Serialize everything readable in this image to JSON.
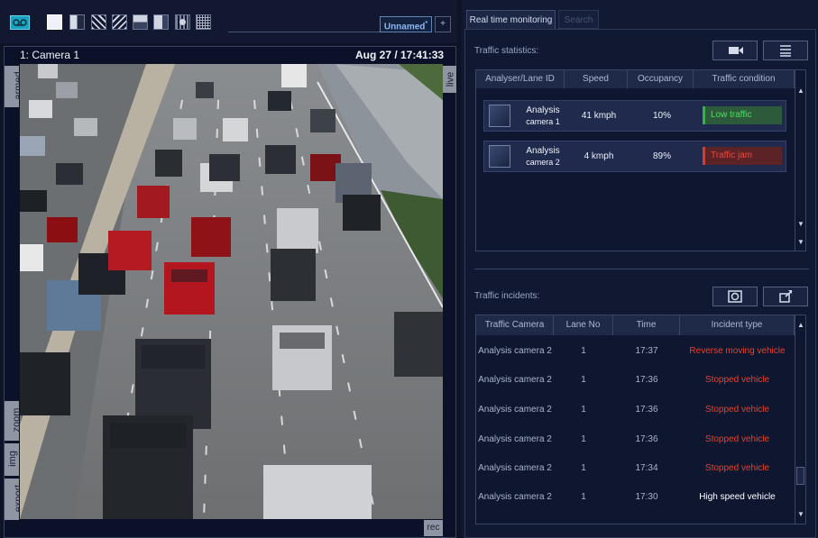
{
  "toolbar": {
    "layout_name": "Unnamed",
    "layout_modified_mark": "*",
    "add_label": "+"
  },
  "video": {
    "title": "1: Camera 1",
    "timestamp": "Aug 27 / 17:41:33",
    "side_tabs": [
      "armed",
      "zoom",
      "img",
      "export"
    ],
    "live_tab": "live",
    "rec_tab": "rec"
  },
  "tabs": [
    "Real time monitoring",
    "Search"
  ],
  "statistics": {
    "title": "Traffic statistics:",
    "columns": [
      "Analyser/Lane ID",
      "Speed",
      "Occupancy",
      "Traffic condition"
    ],
    "rows": [
      {
        "name_line1": "Analysis",
        "name_line2": "camera 1",
        "speed": "41 kmph",
        "occupancy": "10%",
        "condition": "Low traffic",
        "color": "#1fbf3a"
      },
      {
        "name_line1": "Analysis",
        "name_line2": "camera 2",
        "speed": "4 kmph",
        "occupancy": "89%",
        "condition": "Traffic jam",
        "color": "#e0372a"
      }
    ]
  },
  "incidents": {
    "title": "Traffic incidents:",
    "columns": [
      "Traffic Camera",
      "Lane No",
      "Time",
      "Incident type"
    ],
    "rows": [
      {
        "camera": "Analysis camera 2",
        "lane": "1",
        "time": "17:37",
        "type": "Reverse moving vehicle",
        "color": "#e8402c"
      },
      {
        "camera": "Analysis camera 2",
        "lane": "1",
        "time": "17:36",
        "type": "Stopped vehicle",
        "color": "#e8402c"
      },
      {
        "camera": "Analysis camera 2",
        "lane": "1",
        "time": "17:36",
        "type": "Stopped vehicle",
        "color": "#e8402c"
      },
      {
        "camera": "Analysis camera 2",
        "lane": "1",
        "time": "17:36",
        "type": "Stopped vehicle",
        "color": "#e8402c"
      },
      {
        "camera": "Analysis camera 2",
        "lane": "1",
        "time": "17:34",
        "type": "Stopped vehicle",
        "color": "#e8402c"
      },
      {
        "camera": "Analysis camera 2",
        "lane": "1",
        "time": "17:30",
        "type": "High speed vehicle",
        "color": "#ffffff"
      }
    ]
  },
  "icons": {
    "record": "tape-icon",
    "camera_view": "video-camera-icon",
    "list_view": "list-icon",
    "snapshot": "snapshot-icon",
    "export": "export-icon"
  }
}
